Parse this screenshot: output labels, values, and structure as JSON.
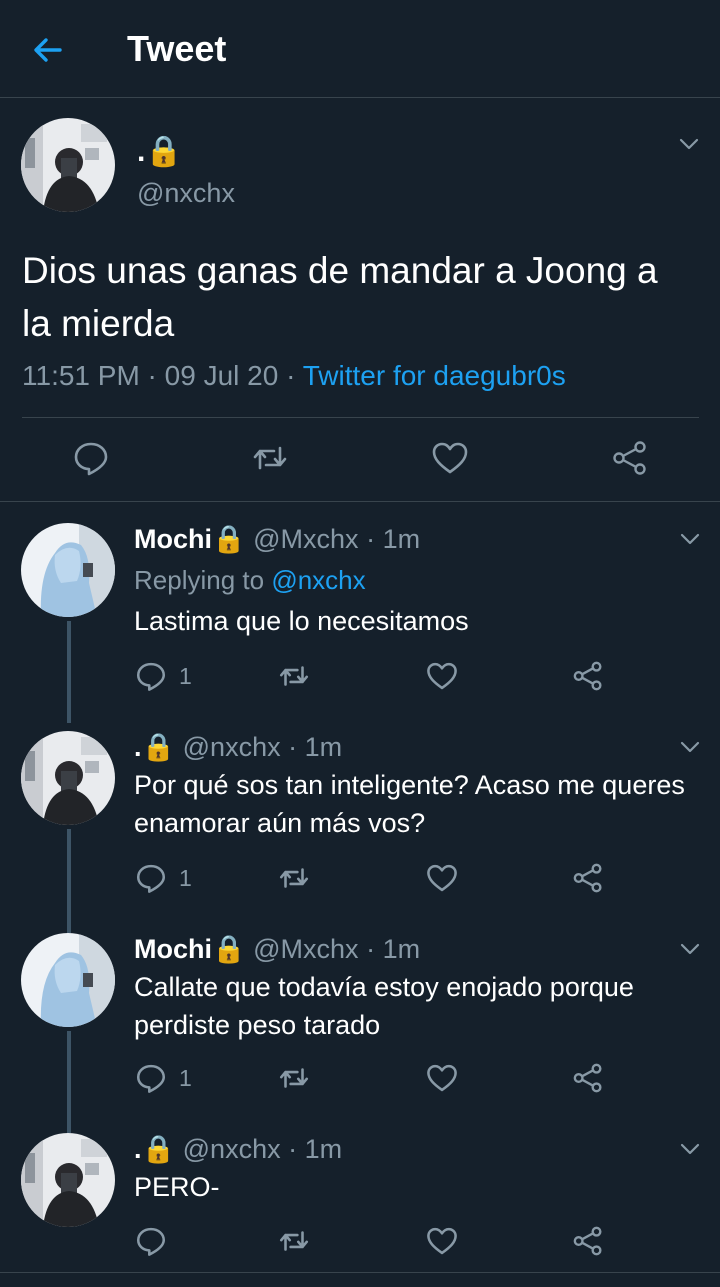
{
  "header": {
    "title": "Tweet"
  },
  "main_tweet": {
    "name": ".🔒",
    "handle": "@nxchx",
    "text": "Dios unas ganas de mandar a Joong a la mierda",
    "time": "11:51 PM",
    "date_sep": " · ",
    "date": "09 Jul 20",
    "source_sep": " · ",
    "source": "Twitter for daegubr0s"
  },
  "replies": [
    {
      "name": "Mochi🔒",
      "handle": "@Mxchx",
      "sep": " · ",
      "time": "1m",
      "replying_label": "Replying to ",
      "replying_to": "@nxchx",
      "text": "Lastima que lo necesitamos",
      "reply_count": "1"
    },
    {
      "name": ".🔒",
      "handle": "@nxchx",
      "sep": " · ",
      "time": "1m",
      "text": "Por qué sos tan inteligente? Acaso me queres enamorar aún más vos?",
      "reply_count": "1"
    },
    {
      "name": "Mochi🔒",
      "handle": "@Mxchx",
      "sep": " · ",
      "time": "1m",
      "text": "Callate que todavía estoy enojado porque perdiste peso tarado",
      "reply_count": "1"
    },
    {
      "name": ".🔒",
      "handle": "@nxchx",
      "sep": " · ",
      "time": "1m",
      "text": "PERO-",
      "reply_count": ""
    }
  ],
  "colors": {
    "background": "#15202b",
    "accent": "#1da1f2",
    "muted": "#8899a6",
    "divider": "#38444d"
  },
  "icons": [
    "back-arrow-icon",
    "chevron-down-icon",
    "reply-icon",
    "retweet-icon",
    "like-icon",
    "share-icon"
  ]
}
